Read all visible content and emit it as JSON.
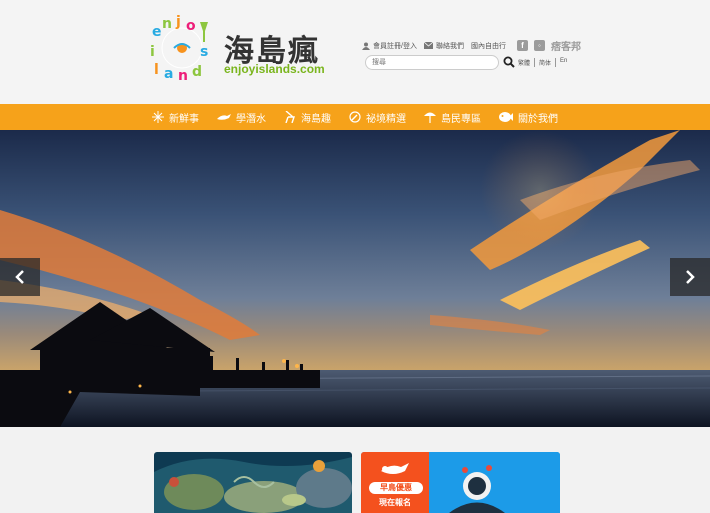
{
  "brand": {
    "title": "海島瘋",
    "subtitle": "enjoyislands.com"
  },
  "top_links": {
    "member": "會員註冊/登入",
    "contact": "聯絡我們",
    "domestic": "國內自由行",
    "blog": "痞客邦"
  },
  "search": {
    "placeholder": "搜尋"
  },
  "languages": [
    "繁體",
    "简体",
    "En"
  ],
  "nav": [
    {
      "label": "新鮮事",
      "icon": "sparkle-icon"
    },
    {
      "label": "學潛水",
      "icon": "diver-icon"
    },
    {
      "label": "海島趣",
      "icon": "beach-chair-icon"
    },
    {
      "label": "祕境精選",
      "icon": "compass-icon"
    },
    {
      "label": "島民專區",
      "icon": "umbrella-icon"
    },
    {
      "label": "關於我們",
      "icon": "fish-icon"
    }
  ],
  "promo": {
    "badge": "早鳥優惠",
    "cta": "現在報名"
  },
  "colors": {
    "nav_bg": "#f6a21a",
    "promo_orange": "#f4511e",
    "promo_blue": "#1c9be8",
    "brand_green": "#7ab51d"
  }
}
